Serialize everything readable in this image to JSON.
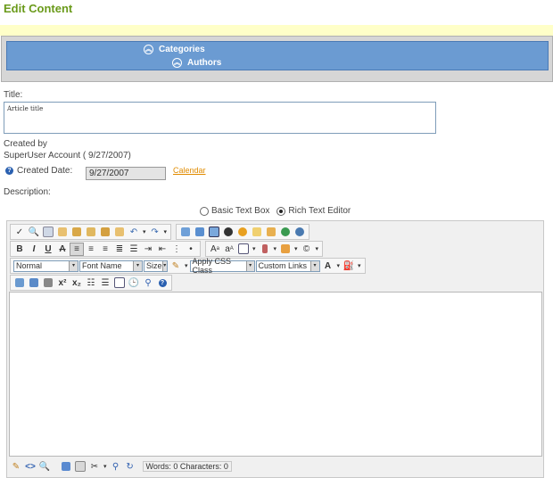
{
  "page": {
    "title": "Edit Content"
  },
  "categories_panel": {
    "categories": "Categories",
    "authors": "Authors"
  },
  "form": {
    "title_label": "Title:",
    "title_value": "Article title",
    "created_by_label": "Created by",
    "created_by_value": "SuperUser Account ( 9/27/2007)",
    "created_date_label": "Created Date:",
    "created_date_value": "9/27/2007",
    "calendar_link": "Calendar",
    "description_label": "Description:",
    "basic_text_box": "Basic Text Box",
    "rich_text_editor": "Rich Text Editor",
    "selected_mode": "Rich Text Editor"
  },
  "editor": {
    "toolbar": {
      "paragraph_format": "Normal",
      "font_name": "Font Name",
      "size": "Size",
      "css_class": "Apply CSS Class",
      "custom_links": "Custom Links"
    },
    "status": "Words: 0 Characters: 0",
    "colors": {
      "accent": "#6b9bd2",
      "title_green": "#6a9a1a",
      "link_orange": "#e08b00"
    }
  }
}
